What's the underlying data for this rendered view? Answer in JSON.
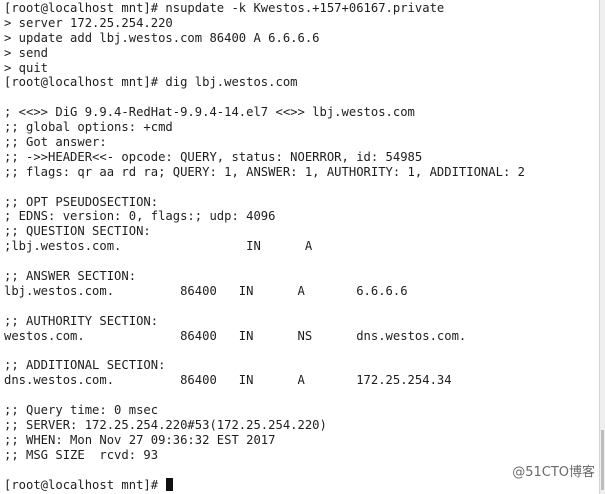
{
  "terminal": {
    "lines": [
      "[root@localhost mnt]# nsupdate -k Kwestos.+157+06167.private",
      "> server 172.25.254.220",
      "> update add lbj.westos.com 86400 A 6.6.6.6",
      "> send",
      "> quit",
      "[root@localhost mnt]# dig lbj.westos.com",
      "",
      "; <<>> DiG 9.9.4-RedHat-9.9.4-14.el7 <<>> lbj.westos.com",
      ";; global options: +cmd",
      ";; Got answer:",
      ";; ->>HEADER<<- opcode: QUERY, status: NOERROR, id: 54985",
      ";; flags: qr aa rd ra; QUERY: 1, ANSWER: 1, AUTHORITY: 1, ADDITIONAL: 2",
      "",
      ";; OPT PSEUDOSECTION:",
      "; EDNS: version: 0, flags:; udp: 4096",
      ";; QUESTION SECTION:",
      ";lbj.westos.com.                 IN      A",
      "",
      ";; ANSWER SECTION:",
      "lbj.westos.com.         86400   IN      A       6.6.6.6",
      "",
      ";; AUTHORITY SECTION:",
      "westos.com.             86400   IN      NS      dns.westos.com.",
      "",
      ";; ADDITIONAL SECTION:",
      "dns.westos.com.         86400   IN      A       172.25.254.34",
      "",
      ";; Query time: 0 msec",
      ";; SERVER: 172.25.254.220#53(172.25.254.220)",
      ";; WHEN: Mon Nov 27 09:36:32 EST 2017",
      ";; MSG SIZE  rcvd: 93",
      "",
      "[root@localhost mnt]# "
    ]
  },
  "watermark": "@51CTO博客",
  "colors": {
    "background": "#ffffff",
    "text": "#1e1e1e"
  }
}
